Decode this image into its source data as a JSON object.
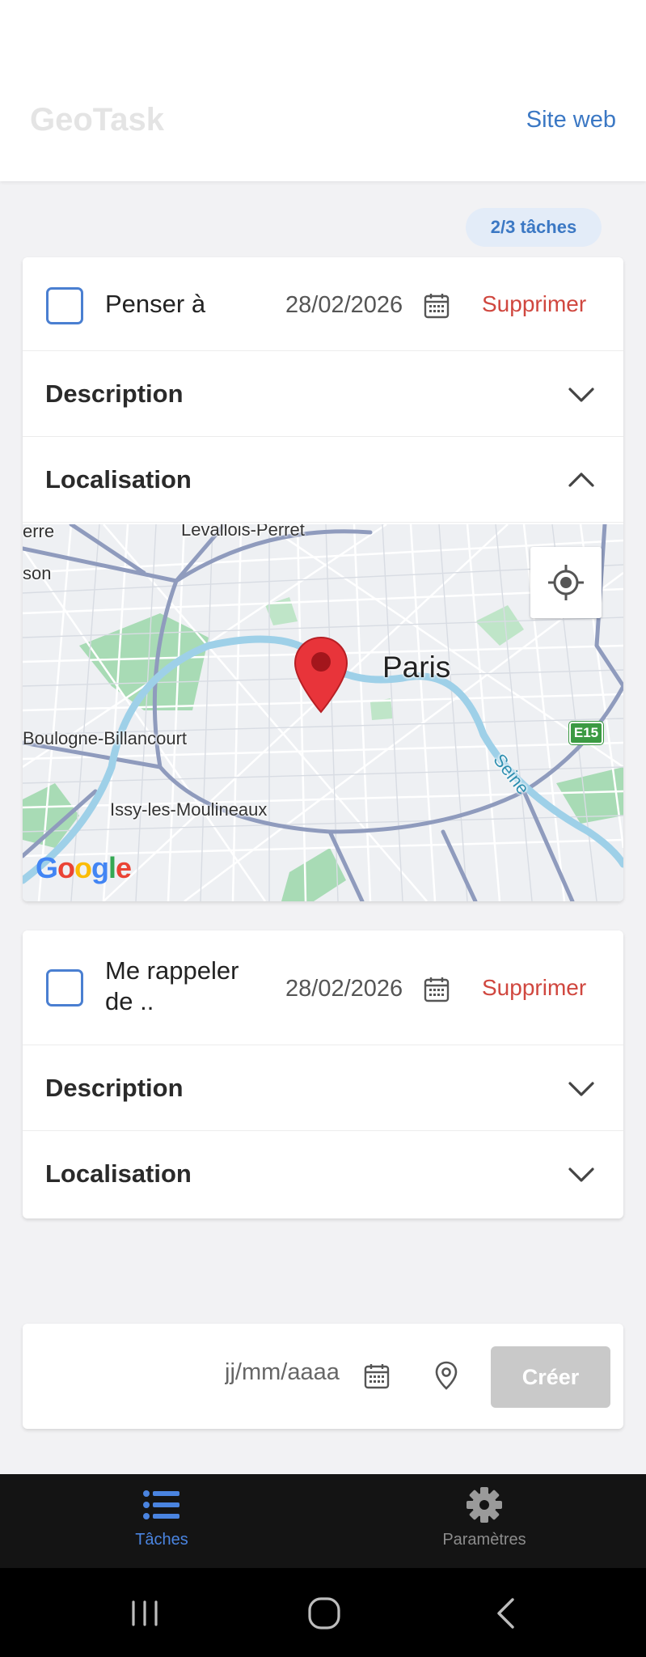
{
  "header": {
    "app_title": "GeoTask",
    "site_link": "Site web"
  },
  "badge": {
    "count_label": "2/3 tâches"
  },
  "tasks": [
    {
      "title": "Penser à",
      "date": "28/02/2026",
      "delete_label": "Supprimer",
      "completed": false,
      "sections": [
        {
          "label": "Description",
          "expanded": false
        },
        {
          "label": "Localisation",
          "expanded": true
        }
      ],
      "map": {
        "labels": {
          "levallois": "Levallois-Perret",
          "erre": "erre",
          "son": "son",
          "paris": "Paris",
          "boulogne": "Boulogne-Billancourt",
          "issy": "Issy-les-Moulineaux",
          "seine": "Seine",
          "e15": "E15"
        },
        "attribution": "Google"
      }
    },
    {
      "title": "Me rappeler de ..",
      "date": "28/02/2026",
      "delete_label": "Supprimer",
      "completed": false,
      "sections": [
        {
          "label": "Description",
          "expanded": false
        },
        {
          "label": "Localisation",
          "expanded": false
        }
      ]
    }
  ],
  "create_form": {
    "date_placeholder": "jj/mm/aaaa",
    "create_label": "Créer"
  },
  "bottom_nav": {
    "items": [
      {
        "label": "Tâches",
        "icon": "list-icon",
        "active": true
      },
      {
        "label": "Paramètres",
        "icon": "gear-icon",
        "active": false
      }
    ]
  },
  "colors": {
    "accent": "#3b78c4",
    "delete": "#d0473f",
    "checkbox": "#4a7fd1",
    "create_disabled": "#c9c9c9",
    "nav_bg": "#141414"
  }
}
